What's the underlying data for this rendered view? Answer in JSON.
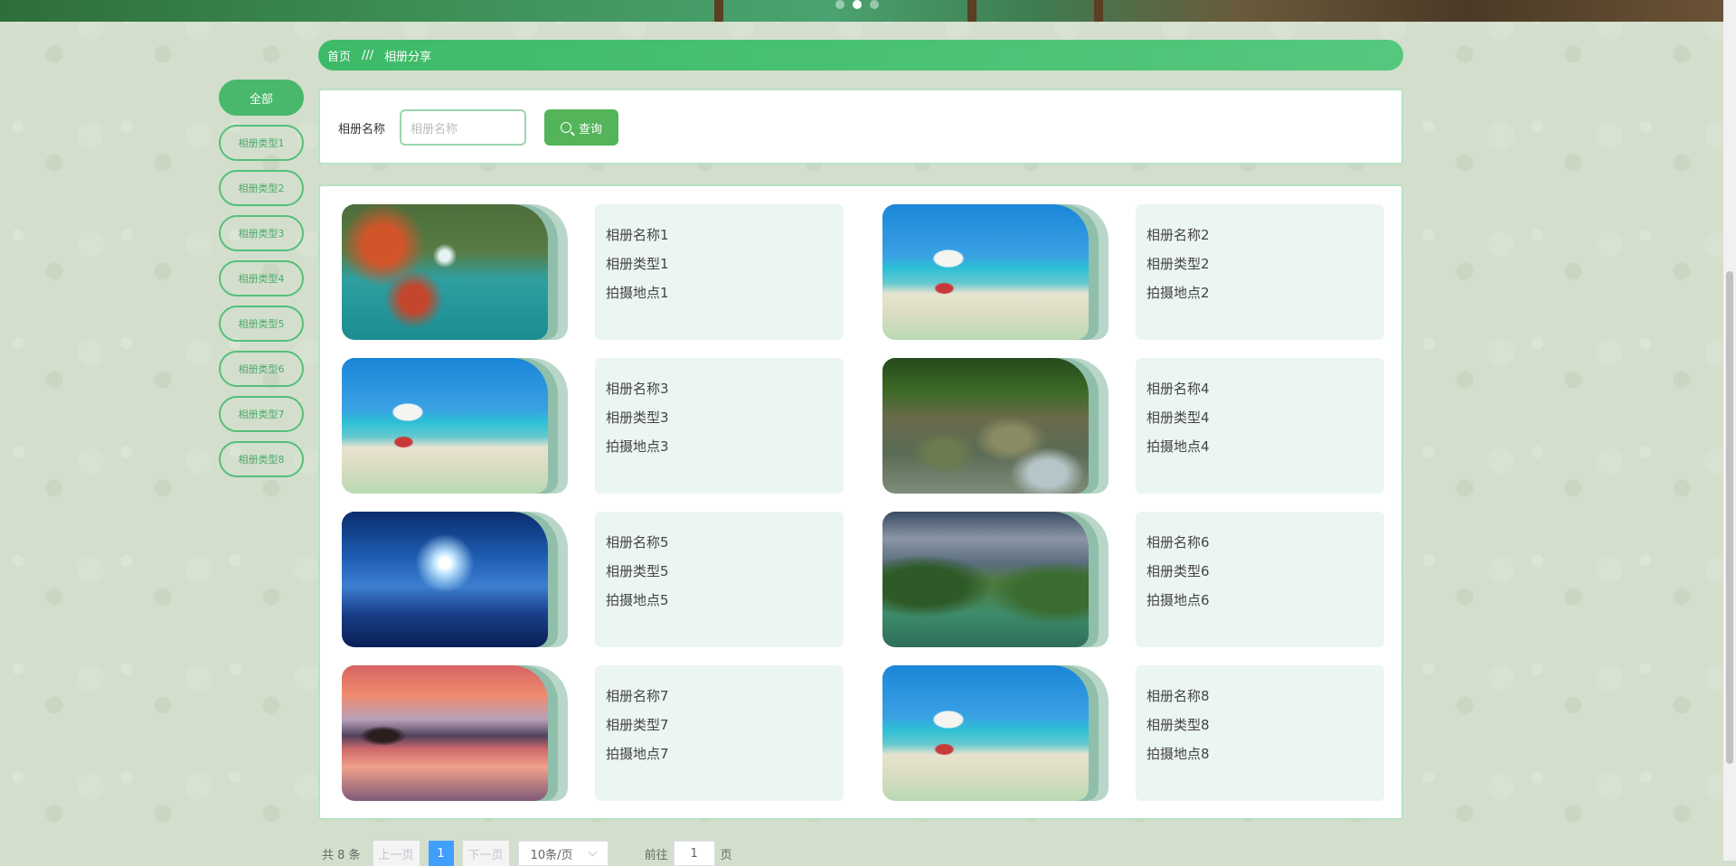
{
  "breadcrumb": {
    "home": "首页",
    "separator": "///",
    "current": "相册分享"
  },
  "sidebar": {
    "all": "全部",
    "items": [
      "相册类型1",
      "相册类型2",
      "相册类型3",
      "相册类型4",
      "相册类型5",
      "相册类型6",
      "相册类型7",
      "相册类型8"
    ]
  },
  "search": {
    "label": "相册名称",
    "placeholder": "相册名称",
    "button": "查询",
    "icon": "search-icon"
  },
  "albums": [
    {
      "name": "相册名称1",
      "type": "相册类型1",
      "location": "拍摄地点1",
      "image": "waterfall"
    },
    {
      "name": "相册名称2",
      "type": "相册类型2",
      "location": "拍摄地点2",
      "image": "beach"
    },
    {
      "name": "相册名称3",
      "type": "相册类型3",
      "location": "拍摄地点3",
      "image": "beach"
    },
    {
      "name": "相册名称4",
      "type": "相册类型4",
      "location": "拍摄地点4",
      "image": "river"
    },
    {
      "name": "相册名称5",
      "type": "相册类型5",
      "location": "拍摄地点5",
      "image": "snow"
    },
    {
      "name": "相册名称6",
      "type": "相册类型6",
      "location": "拍摄地点6",
      "image": "trees"
    },
    {
      "name": "相册名称7",
      "type": "相册类型7",
      "location": "拍摄地点7",
      "image": "sunset"
    },
    {
      "name": "相册名称8",
      "type": "相册类型8",
      "location": "拍摄地点8",
      "image": "beach"
    }
  ],
  "pagination": {
    "total": "共 8 条",
    "prev": "上一页",
    "current": "1",
    "next": "下一页",
    "page_size": "10条/页",
    "goto_prefix": "前往",
    "goto_value": "1",
    "goto_suffix": "页"
  },
  "colors": {
    "accent": "#49b86c",
    "breadcrumb": "#3dba68",
    "card_bg": "#ecf6f0",
    "pager_active": "#409eff"
  }
}
